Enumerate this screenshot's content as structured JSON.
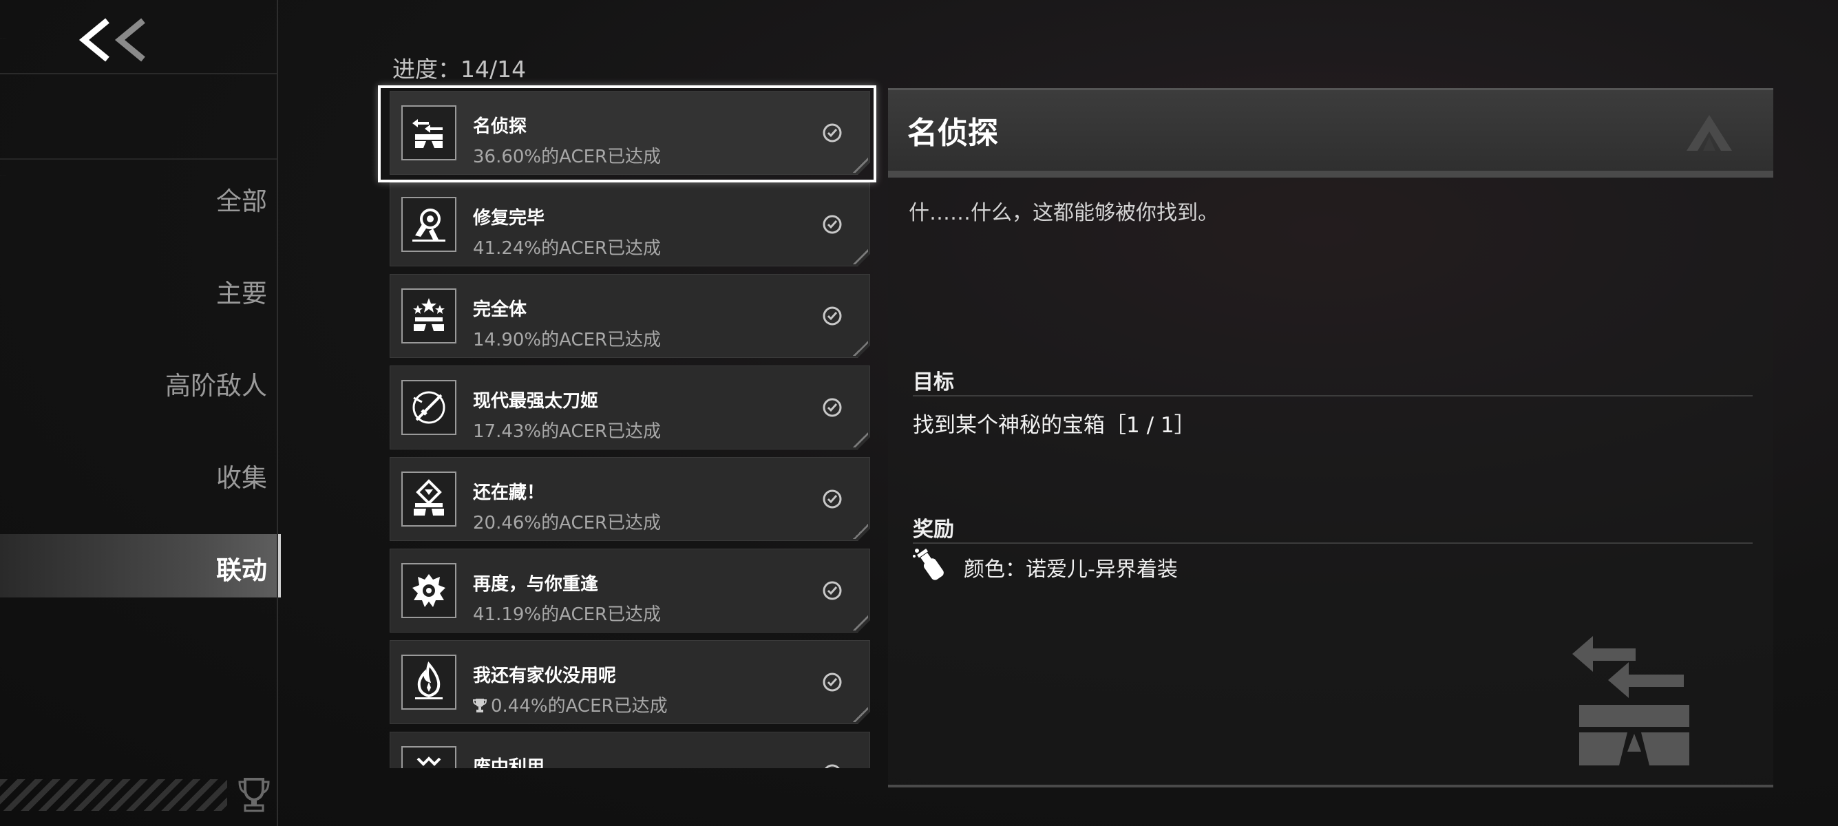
{
  "sidebar": {
    "categories": [
      {
        "label": "全部"
      },
      {
        "label": "主要"
      },
      {
        "label": "高阶敌人"
      },
      {
        "label": "收集"
      },
      {
        "label": "联动"
      }
    ],
    "active_index": 4
  },
  "progress": {
    "text": "进度：14/14"
  },
  "achievements": [
    {
      "name": "名侦探",
      "percent_text": "36.60%的ACER已达成",
      "icon": "detective-icon",
      "completed": true
    },
    {
      "name": "修复完毕",
      "percent_text": "41.24%的ACER已达成",
      "icon": "robot-repair-icon",
      "completed": true
    },
    {
      "name": "完全体",
      "percent_text": "14.90%的ACER已达成",
      "icon": "stars-podium-icon",
      "completed": true
    },
    {
      "name": "现代最强太刀姬",
      "percent_text": "17.43%的ACER已达成",
      "icon": "katana-icon",
      "completed": true
    },
    {
      "name": "还在藏！",
      "percent_text": "20.46%的ACER已达成",
      "icon": "hidden-chest-icon",
      "completed": true
    },
    {
      "name": "再度，与你重逢",
      "percent_text": "41.19%的ACER已达成",
      "icon": "spiky-creature-icon",
      "completed": true
    },
    {
      "name": "我还有家伙没用呢",
      "percent_text": "0.44%的ACER已达成",
      "icon": "flame-icon",
      "completed": true,
      "trophy": true
    },
    {
      "name": "废中利用",
      "percent_text": "",
      "icon": "scrap-icon",
      "completed": true
    }
  ],
  "detail": {
    "title": "名侦探",
    "description": "什……什么，这都能够被你找到。",
    "goal_label": "目标",
    "goal_text": "找到某个神秘的宝箱［1 / 1］",
    "reward_label": "奖励",
    "reward_text": "颜色：诺爱儿-异界着装",
    "reward_icon": "paint-bottle-icon",
    "header_logo": "game-logo-icon"
  },
  "colors": {
    "accent": "#ffffff",
    "panel": "#2b2b2b",
    "text_dim": "#a8a8a8"
  }
}
